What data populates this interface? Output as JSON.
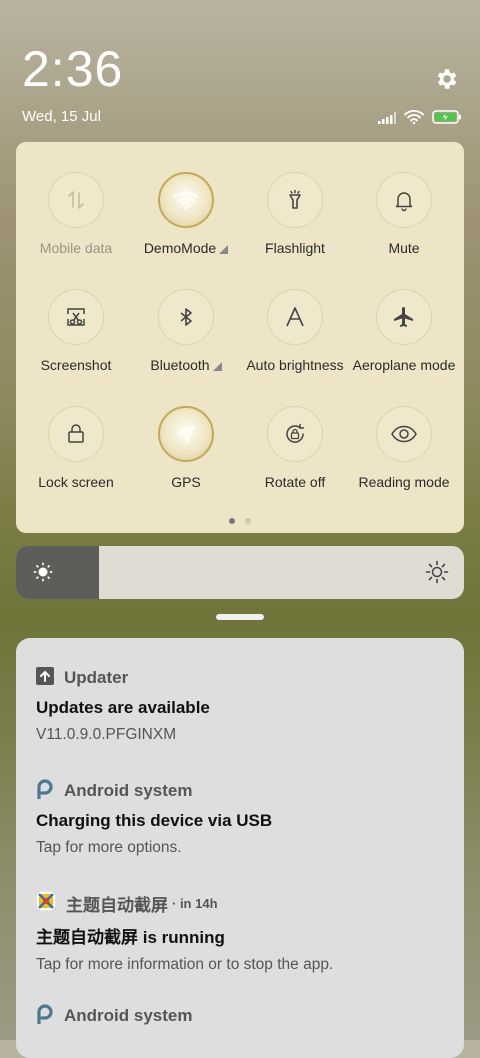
{
  "status": {
    "time": "2:36",
    "date": "Wed, 15 Jul"
  },
  "tiles": [
    {
      "label": "Mobile data",
      "icon": "mobile-data-icon",
      "active": false,
      "disabled": true,
      "expandable": false
    },
    {
      "label": "DemoMode",
      "icon": "wifi-icon",
      "active": true,
      "disabled": false,
      "expandable": true
    },
    {
      "label": "Flashlight",
      "icon": "flashlight-icon",
      "active": false,
      "disabled": false,
      "expandable": false
    },
    {
      "label": "Mute",
      "icon": "bell-icon",
      "active": false,
      "disabled": false,
      "expandable": false
    },
    {
      "label": "Screenshot",
      "icon": "screenshot-icon",
      "active": false,
      "disabled": false,
      "expandable": false
    },
    {
      "label": "Bluetooth",
      "icon": "bluetooth-icon",
      "active": false,
      "disabled": false,
      "expandable": true
    },
    {
      "label": "Auto brightness",
      "icon": "auto-brightness-icon",
      "active": false,
      "disabled": false,
      "expandable": false
    },
    {
      "label": "Aeroplane mode",
      "icon": "aeroplane-icon",
      "active": false,
      "disabled": false,
      "expandable": false
    },
    {
      "label": "Lock screen",
      "icon": "lock-icon",
      "active": false,
      "disabled": false,
      "expandable": false
    },
    {
      "label": "GPS",
      "icon": "gps-icon",
      "active": true,
      "disabled": false,
      "expandable": false
    },
    {
      "label": "Rotate off",
      "icon": "rotate-lock-icon",
      "active": false,
      "disabled": false,
      "expandable": false
    },
    {
      "label": "Reading mode",
      "icon": "eye-icon",
      "active": false,
      "disabled": false,
      "expandable": false
    }
  ],
  "page_indicator": {
    "pages": 2,
    "current": 1
  },
  "brightness": {
    "level": 0.15
  },
  "notifications": [
    {
      "app": "Updater",
      "app_icon": "upload-arrow-icon",
      "time": "",
      "title": "Updates are available",
      "text": "V11.0.9.0.PFGINXM"
    },
    {
      "app": "Android system",
      "app_icon": "android-p-icon",
      "time": "",
      "title": "Charging this device via USB",
      "text": "Tap for more options."
    },
    {
      "app": "主题自动截屏",
      "app_icon": "theme-app-icon",
      "time": "· in 14h",
      "title": "主题自动截屏 is running",
      "text": "Tap for more information or to stop the app."
    },
    {
      "app": "Android system",
      "app_icon": "android-p-icon",
      "time": "",
      "title": "",
      "text": ""
    }
  ],
  "colors": {
    "panel": "#ede5c6",
    "accent": "#c4aa56",
    "battery": "#4cc84c"
  }
}
